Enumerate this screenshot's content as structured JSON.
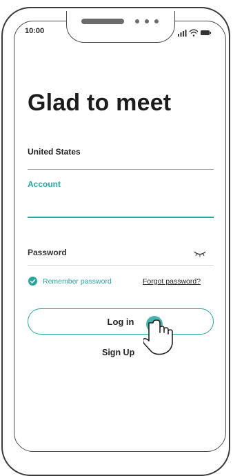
{
  "status_bar": {
    "time": "10:00",
    "icons": [
      "signal-icon",
      "wifi-icon",
      "battery-icon"
    ]
  },
  "screen": {
    "title": "Glad to meet",
    "country": "United States",
    "account_label": "Account",
    "account_value": "",
    "password_label": "Password",
    "remember_label": "Remember password",
    "remember_checked": true,
    "forgot_label": "Forgot password?",
    "login_label": "Log in",
    "signup_label": "Sign Up"
  },
  "colors": {
    "accent": "#2aa6a0",
    "text": "#222222",
    "line": "#9a9a9a"
  }
}
